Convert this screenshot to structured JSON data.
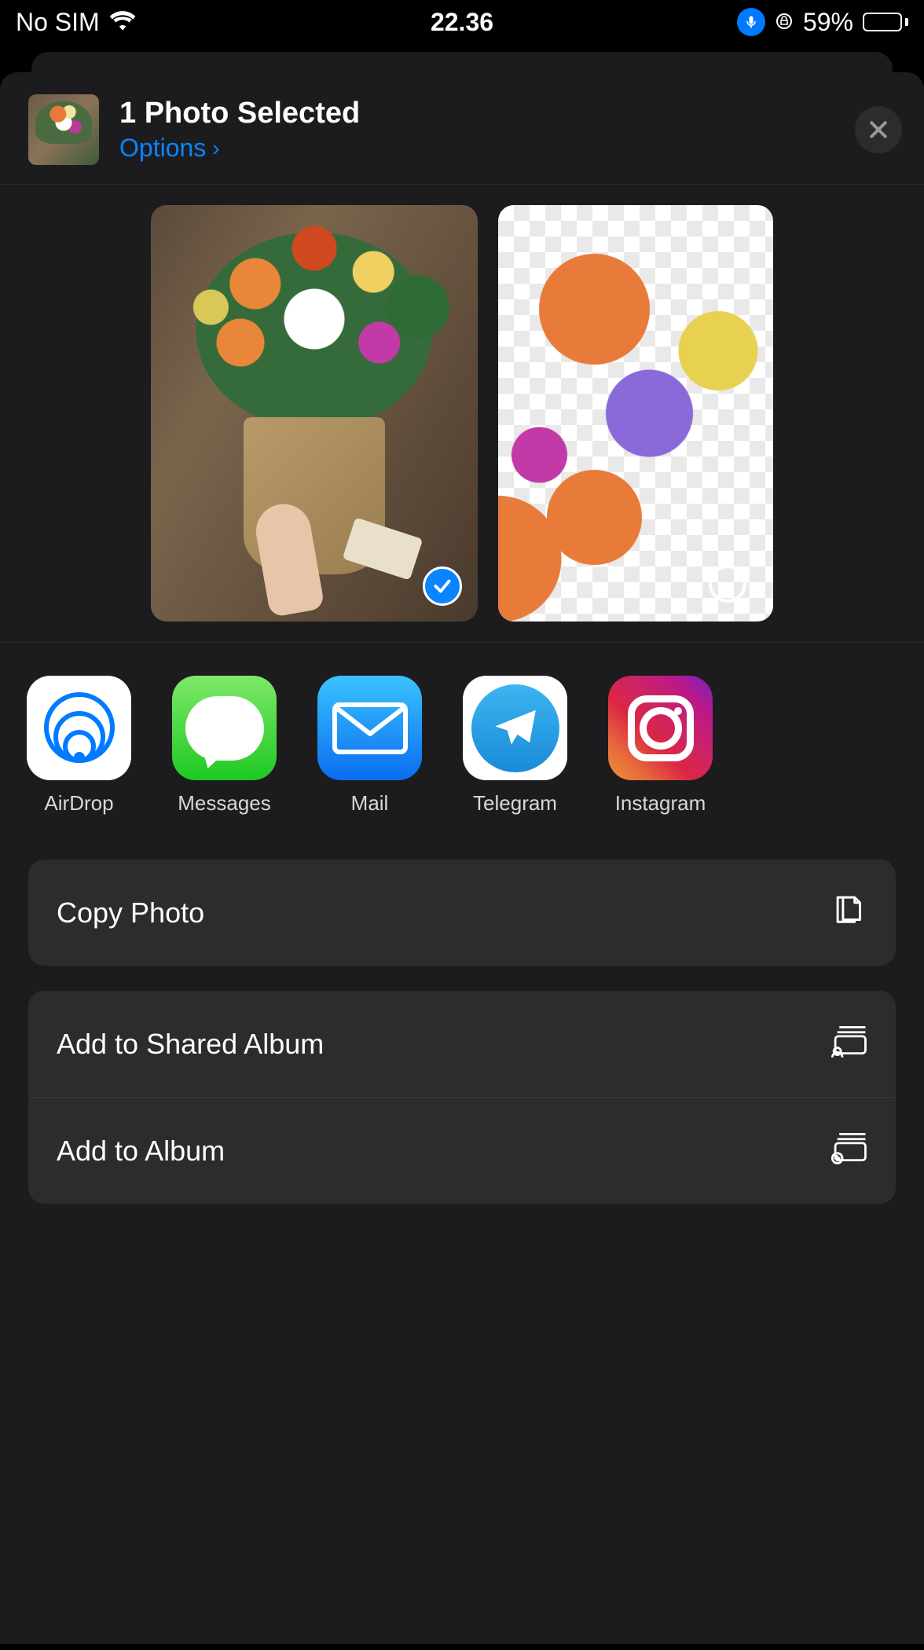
{
  "status_bar": {
    "carrier": "No SIM",
    "time": "22.36",
    "battery_percent": "59%",
    "battery_level": 59
  },
  "header": {
    "title": "1 Photo Selected",
    "options_label": "Options"
  },
  "apps": [
    {
      "label": "AirDrop"
    },
    {
      "label": "Messages"
    },
    {
      "label": "Mail"
    },
    {
      "label": "Telegram"
    },
    {
      "label": "Instagram"
    }
  ],
  "actions": {
    "copy": "Copy Photo",
    "shared_album": "Add to Shared Album",
    "album": "Add to Album"
  }
}
